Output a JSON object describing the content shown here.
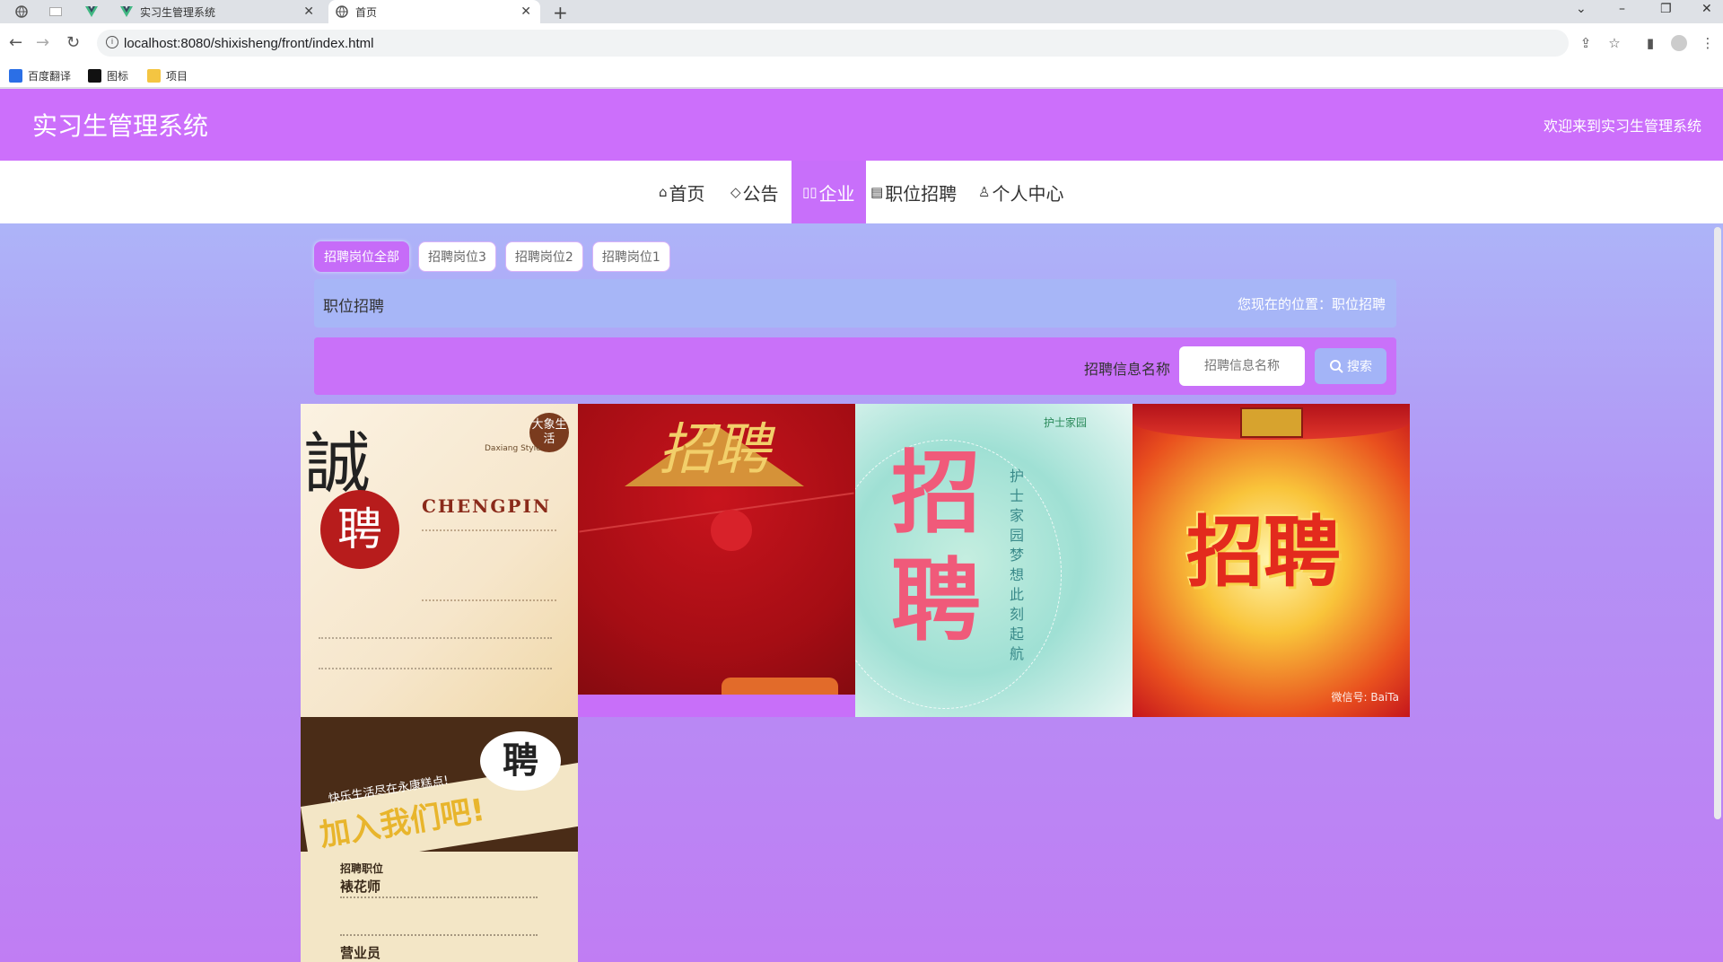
{
  "browser": {
    "tabs": [
      {
        "title": "实习生管理系统"
      },
      {
        "title": "首页"
      }
    ],
    "url": "localhost:8080/shixisheng/front/index.html",
    "bookmarks": [
      "百度翻译",
      "图标",
      "项目"
    ]
  },
  "header": {
    "title": "实习生管理系统",
    "welcome": "欢迎来到实习生管理系统"
  },
  "nav": {
    "items": [
      {
        "label": "首页",
        "icon": "home-icon"
      },
      {
        "label": "公告",
        "icon": "tag-icon"
      },
      {
        "label": "企业",
        "icon": "building-icon",
        "active": true
      },
      {
        "label": "职位招聘",
        "icon": "calendar-icon"
      },
      {
        "label": "个人中心",
        "icon": "user-icon"
      }
    ]
  },
  "filters": [
    "招聘岗位全部",
    "招聘岗位3",
    "招聘岗位2",
    "招聘岗位1"
  ],
  "breadcrumb": {
    "title": "职位招聘",
    "position": "您现在的位置：职位招聘"
  },
  "search": {
    "label": "招聘信息名称",
    "placeholder": "招聘信息名称",
    "button": "搜索"
  },
  "cards": {
    "c1": {
      "big1": "誠",
      "big2": "聘",
      "sub": "CHENGPIN",
      "brand": "大象生活",
      "brand_en": "Daxiang Style"
    },
    "c2": {
      "title": "招聘"
    },
    "c3": {
      "t1": "招",
      "t2": "聘",
      "brand": "护士家园",
      "vertical": "护士家园 梦想此刻起航"
    },
    "c4": {
      "title": "招聘",
      "watermark": "微信号: BaiTa"
    },
    "c5": {
      "badge": "聘",
      "slogan": "快乐生活尽在永康糕点!",
      "headline": "加入我们吧!",
      "section": "招聘职位",
      "job1": "裱花师",
      "job2": "营业员"
    }
  },
  "colors": {
    "header": "#cc6ffb",
    "active_nav": "#c86ffa",
    "breadcrumb": "#a7b6f7",
    "search_bar": "#c971f9"
  }
}
